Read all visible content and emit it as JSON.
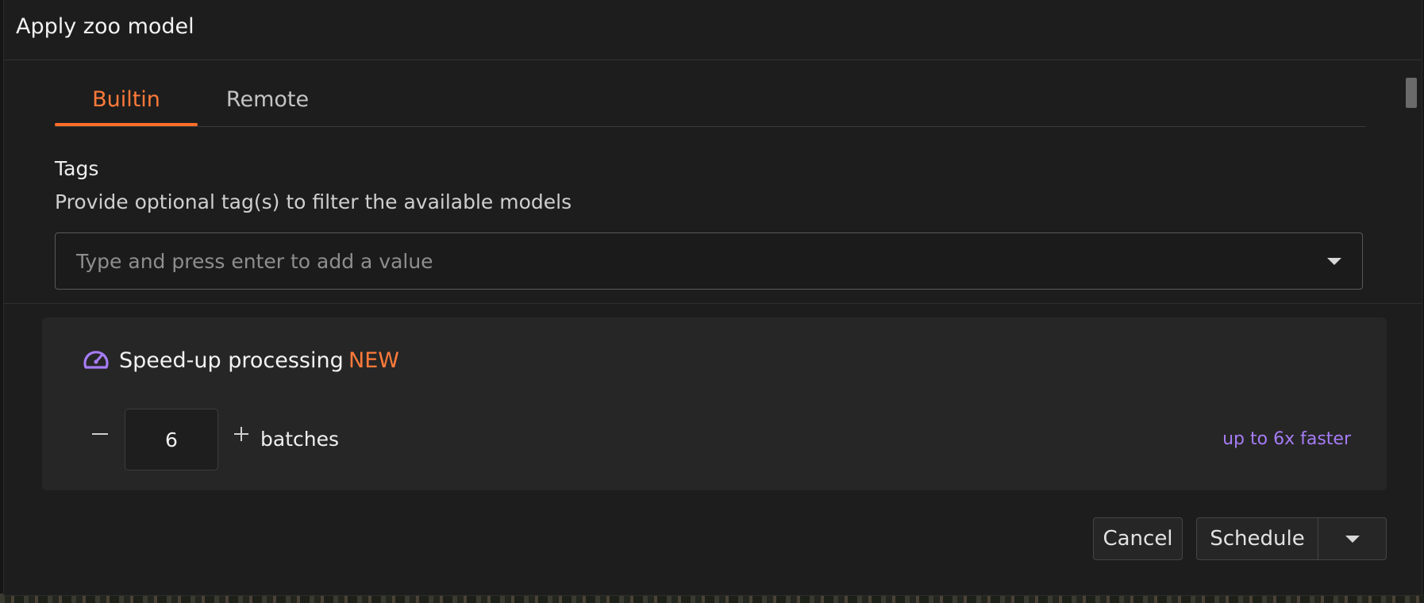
{
  "dialog": {
    "title": "Apply zoo model"
  },
  "tabs": [
    {
      "label": "Builtin",
      "active": true
    },
    {
      "label": "Remote",
      "active": false
    }
  ],
  "tags": {
    "label": "Tags",
    "help": "Provide optional tag(s) to filter the available models",
    "placeholder": "Type and press enter to add a value",
    "value": ""
  },
  "speedup": {
    "title": "Speed-up processing",
    "badge": "NEW",
    "batches_value": "6",
    "batches_label": "batches",
    "hint": "up to 6x faster",
    "icon": "gauge-icon"
  },
  "actions": {
    "cancel_label": "Cancel",
    "schedule_label": "Schedule"
  },
  "colors": {
    "accent": "#ff7a3a",
    "purple": "#a67cf5",
    "background": "#1d1d1d",
    "panel": "#262626"
  }
}
